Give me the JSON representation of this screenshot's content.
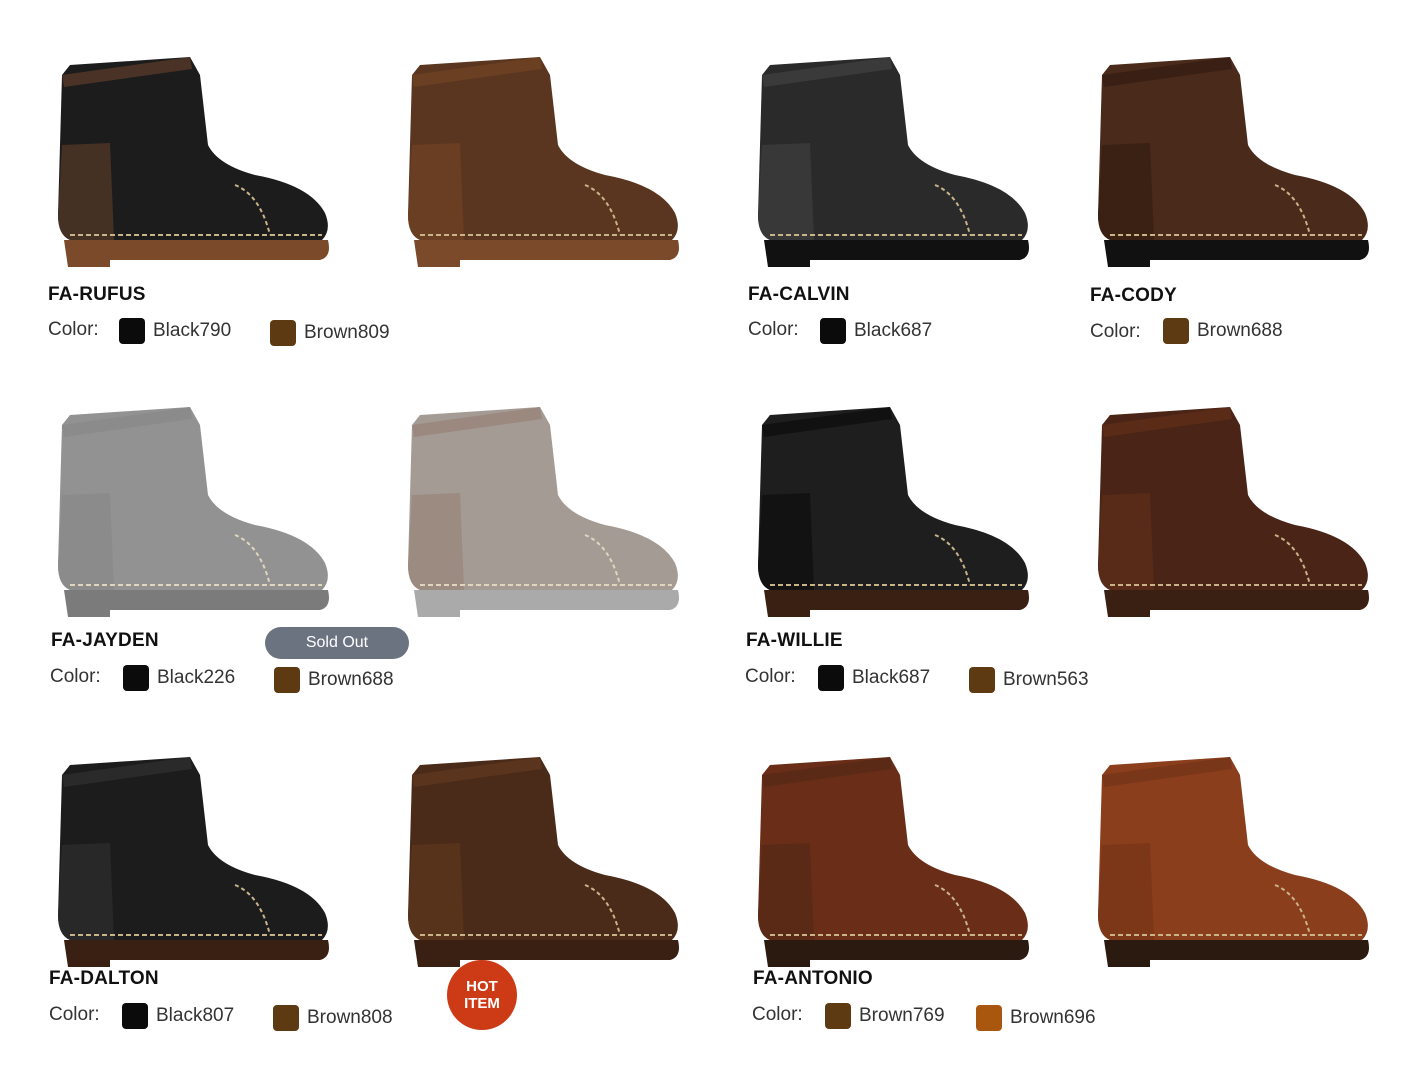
{
  "products": [
    {
      "name": "FA-RUFUS",
      "color_label": "Color:",
      "variants": [
        {
          "label": "Black790",
          "color": "#0b0b0b"
        },
        {
          "label": "Brown809",
          "color": "#5e3a12"
        }
      ]
    },
    {
      "name": "FA-CALVIN",
      "color_label": "Color:",
      "variants": [
        {
          "label": "Black687",
          "color": "#0b0b0b"
        }
      ]
    },
    {
      "name": "FA-CODY",
      "color_label": "Color:",
      "variants": [
        {
          "label": "Brown688",
          "color": "#5e3a12"
        }
      ]
    },
    {
      "name": "FA-JAYDEN",
      "color_label": "Color:",
      "badge": "Sold Out",
      "variants": [
        {
          "label": "Black226",
          "color": "#0b0b0b"
        },
        {
          "label": "Brown688",
          "color": "#5e3a12"
        }
      ]
    },
    {
      "name": "FA-WILLIE",
      "color_label": "Color:",
      "variants": [
        {
          "label": "Black687",
          "color": "#0b0b0b"
        },
        {
          "label": "Brown563",
          "color": "#5e3a12"
        }
      ]
    },
    {
      "name": "FA-DALTON",
      "color_label": "Color:",
      "badge_line1": "HOT",
      "badge_line2": "ITEM",
      "variants": [
        {
          "label": "Black807",
          "color": "#0b0b0b"
        },
        {
          "label": "Brown808",
          "color": "#5e3a12"
        }
      ]
    },
    {
      "name": "FA-ANTONIO",
      "color_label": "Color:",
      "variants": [
        {
          "label": "Brown769",
          "color": "#5e3a12"
        },
        {
          "label": "Brown696",
          "color": "#a9560f"
        }
      ]
    }
  ],
  "boot_images": [
    {
      "icon": "black-lace-up-boot-image",
      "upper": "#1c1c1c",
      "accent": "#4a3326",
      "sole": "#7b4a2a"
    },
    {
      "icon": "brown-lace-up-boot-image",
      "upper": "#5a3520",
      "accent": "#6b3f22",
      "sole": "#7b4a2a"
    },
    {
      "icon": "black-combat-boot-image",
      "upper": "#2a2a2a",
      "accent": "#3a3a3a",
      "sole": "#111111"
    },
    {
      "icon": "brown-zip-boot-image",
      "upper": "#4a2a1a",
      "accent": "#3a2014",
      "sole": "#111111"
    },
    {
      "icon": "black-chelsea-boot-image",
      "upper": "#3a3a3a",
      "accent": "#2e2e2e",
      "sole": "#111111"
    },
    {
      "icon": "brown-chelsea-boot-image",
      "upper": "#5a4a3e",
      "accent": "#4a2a18",
      "sole": "#666666"
    },
    {
      "icon": "black-side-zip-boot-image",
      "upper": "#1e1e1e",
      "accent": "#111111",
      "sole": "#3a2012"
    },
    {
      "icon": "brown-side-zip-boot-image",
      "upper": "#4a2416",
      "accent": "#5a2c18",
      "sole": "#3a2012"
    },
    {
      "icon": "black-buckle-boot-image",
      "upper": "#1c1c1c",
      "accent": "#2a2a2a",
      "sole": "#3a2012"
    },
    {
      "icon": "brown-buckle-boot-image",
      "upper": "#4a2a18",
      "accent": "#5a341c",
      "sole": "#3a2012"
    },
    {
      "icon": "brown-strap-boot-image",
      "upper": "#6a2e18",
      "accent": "#5a2a16",
      "sole": "#2a1a10"
    },
    {
      "icon": "tan-strap-boot-image",
      "upper": "#8a3e1c",
      "accent": "#7a3618",
      "sole": "#2a1a10"
    }
  ]
}
